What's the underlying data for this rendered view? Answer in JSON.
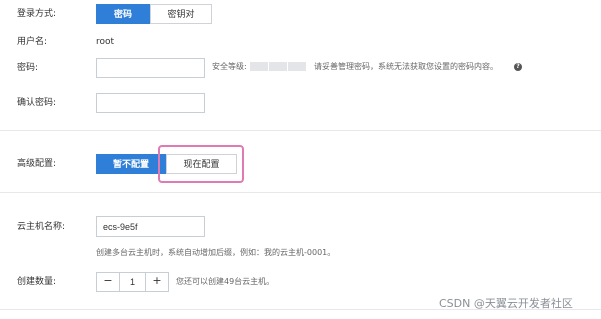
{
  "login": {
    "label": "登录方式:",
    "options": [
      "密码",
      "密钥对"
    ],
    "selected": "密码"
  },
  "username": {
    "label": "用户名:",
    "value": "root"
  },
  "password": {
    "label": "密码:",
    "value": "",
    "strength_label": "安全等级:",
    "hint": "请妥善管理密码，系统无法获取您设置的密码内容。"
  },
  "confirm_password": {
    "label": "确认密码:",
    "value": ""
  },
  "advanced": {
    "label": "高级配置:",
    "options": [
      "暂不配置",
      "现在配置"
    ],
    "selected": "暂不配置"
  },
  "instance_name": {
    "label": "云主机名称:",
    "value": "ecs-9e5f",
    "hint": "创建多台云主机时，系统自动增加后缀，例如：我的云主机-0001。"
  },
  "quantity": {
    "label": "创建数量:",
    "value": "1",
    "minus": "−",
    "plus": "+",
    "remaining": "您还可以创建49台云主机。"
  },
  "watermark": "CSDN @天翼云开发者社区",
  "colors": {
    "accent": "#2f7fd8",
    "highlight": "#e07ab3"
  }
}
